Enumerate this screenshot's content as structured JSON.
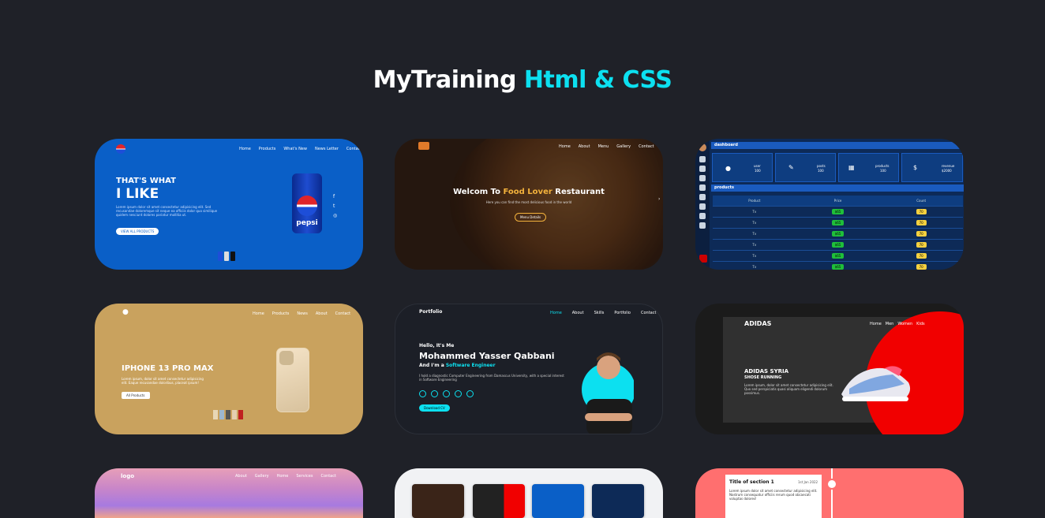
{
  "page": {
    "title_main": "MyTraining",
    "title_accent": "Html & CSS",
    "accent_color": "#0ce0f0",
    "background_color": "#1f2128"
  },
  "projects": [
    {
      "nav": [
        "Home",
        "Products",
        "What's New",
        "News Letter",
        "Contact"
      ],
      "heading_small": "THAT'S WHAT",
      "heading_big": "I LIKE",
      "paragraph": "Lorem ipsum dolor sit amet consectetur adipisicing elit. Sed recusandae doloremque sit neque ea officiis dolor quo similique quidem nesciunt dolores pariatur mollitia ut.",
      "button": "VIEW ALL PRODUCTS",
      "can_text": "pepsi",
      "color": "#0a5fc7"
    },
    {
      "nav": [
        "Home",
        "About",
        "Menu",
        "Gallery",
        "Contact"
      ],
      "heading_pre": "Welcom To",
      "heading_accent": "Food Lover",
      "heading_post": "Restaurant",
      "paragraph": "Here you can find the most delicious food in the world",
      "button": "Menu Details",
      "color": "#3a2418"
    },
    {
      "header": "dashboard",
      "stats": [
        {
          "label": "user",
          "value": "100"
        },
        {
          "label": "posts",
          "value": "100"
        },
        {
          "label": "products",
          "value": "100"
        },
        {
          "label": "revenue",
          "value": "$2000"
        }
      ],
      "table_title": "products",
      "columns": [
        "Product",
        "Price",
        "Count"
      ],
      "rows": [
        {
          "product": "Tv",
          "price": "$65",
          "count": "70"
        },
        {
          "product": "Tv",
          "price": "$65",
          "count": "70"
        },
        {
          "product": "Tv",
          "price": "$65",
          "count": "70"
        },
        {
          "product": "Tv",
          "price": "$65",
          "count": "70"
        },
        {
          "product": "Tv",
          "price": "$65",
          "count": "70"
        },
        {
          "product": "Tv",
          "price": "$65",
          "count": "70"
        }
      ],
      "color": "#0d2a57"
    },
    {
      "nav": [
        "Home",
        "Products",
        "News",
        "About",
        "Contact"
      ],
      "heading": "IPHONE 13 PRO MAX",
      "paragraph": "Lorem ipsum, dolor sit amet consectetur adipisicing elit. Eaque recusandae doloribus, placeat ipsum!",
      "button": "All Products",
      "color": "#c9a25e"
    },
    {
      "brand": "Portfolio",
      "nav": [
        "Home",
        "About",
        "Skills",
        "Portfolio",
        "Contact"
      ],
      "greeting": "Hello, It's Me",
      "name": "Mohammed Yasser Qabbani",
      "role_pre": "And I'm a",
      "role": "Software Engineer",
      "paragraph": "I hold a diagnostic Computer Engineering from Damascus University, with a special interest in Software Engineering",
      "button": "Download CV",
      "color": "#1c1f27"
    },
    {
      "brand": "ADIDAS",
      "nav": [
        "Home",
        "Men",
        "Women",
        "Kids"
      ],
      "heading": "ADIDAS SYRIA",
      "subheading": "SHOSE RUNNING",
      "paragraph": "Lorem ipsum, dolor sit amet consectetur adipisicing elit. Quo sed perspiciatis quasi aliquam eligendi dolorum possimus.",
      "color": "#1b1b1b"
    },
    {
      "logo": "logo",
      "nav": [
        "About",
        "Gallery",
        "Home",
        "Services",
        "Contact"
      ]
    },
    {
      "thumbs": [
        "food",
        "adidas",
        "pepsi",
        "dashboard"
      ]
    },
    {
      "section_title": "Title of section 1",
      "date": "1st Jan 2022",
      "paragraph": "Lorem ipsum dolor sit amet consectetur adipisicing elit. Nostrum consequatur officiis rerum quod obcaecati voluptas dolores!",
      "color": "#ff6f6f"
    }
  ]
}
